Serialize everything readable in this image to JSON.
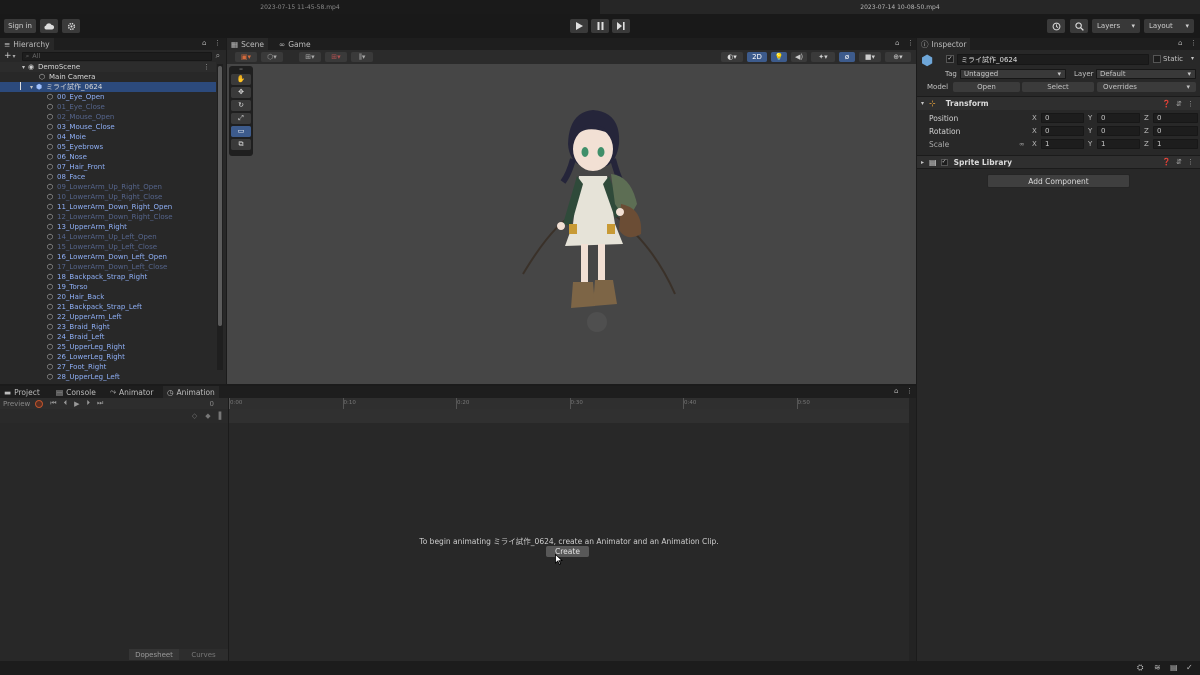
{
  "os_tabs": [
    "2023-07-15 11-45-58.mp4",
    "2023-07-14 10-08-50.mp4"
  ],
  "toolbar": {
    "sign_in": "Sign in",
    "layers": "Layers",
    "layout": "Layout"
  },
  "hierarchy": {
    "tab": "Hierarchy",
    "search_placeholder": "All",
    "scene": "DemoScene",
    "root_items": [
      {
        "label": "Main Camera",
        "state": "white"
      },
      {
        "label": "ミライ試作_0624",
        "state": "white"
      }
    ],
    "children": [
      {
        "label": "00_Eye_Open",
        "state": "blue"
      },
      {
        "label": "01_Eye_Close",
        "state": "dim"
      },
      {
        "label": "02_Mouse_Open",
        "state": "dim"
      },
      {
        "label": "03_Mouse_Close",
        "state": "blue"
      },
      {
        "label": "04_Moie",
        "state": "blue"
      },
      {
        "label": "05_Eyebrows",
        "state": "blue"
      },
      {
        "label": "06_Nose",
        "state": "blue"
      },
      {
        "label": "07_Hair_Front",
        "state": "blue"
      },
      {
        "label": "08_Face",
        "state": "blue"
      },
      {
        "label": "09_LowerArm_Up_Right_Open",
        "state": "dim"
      },
      {
        "label": "10_LowerArm_Up_Right_Close",
        "state": "dim"
      },
      {
        "label": "11_LowerArm_Down_Right_Open",
        "state": "blue"
      },
      {
        "label": "12_LowerArm_Down_Right_Close",
        "state": "dim"
      },
      {
        "label": "13_UpperArm_Right",
        "state": "blue"
      },
      {
        "label": "14_LowerArm_Up_Left_Open",
        "state": "dim"
      },
      {
        "label": "15_LowerArm_Up_Left_Close",
        "state": "dim"
      },
      {
        "label": "16_LowerArm_Down_Left_Open",
        "state": "blue"
      },
      {
        "label": "17_LowerArm_Down_Left_Close",
        "state": "dim"
      },
      {
        "label": "18_Backpack_Strap_Right",
        "state": "blue"
      },
      {
        "label": "19_Torso",
        "state": "blue"
      },
      {
        "label": "20_Hair_Back",
        "state": "blue"
      },
      {
        "label": "21_Backpack_Strap_Left",
        "state": "blue"
      },
      {
        "label": "22_UpperArm_Left",
        "state": "blue"
      },
      {
        "label": "23_Braid_Right",
        "state": "blue"
      },
      {
        "label": "24_Braid_Left",
        "state": "blue"
      },
      {
        "label": "25_UpperLeg_Right",
        "state": "blue"
      },
      {
        "label": "26_LowerLeg_Right",
        "state": "blue"
      },
      {
        "label": "27_Foot_Right",
        "state": "blue"
      },
      {
        "label": "28_UpperLeg_Left",
        "state": "blue"
      }
    ]
  },
  "scene": {
    "tabs": [
      "Scene",
      "Game"
    ],
    "mode_2d": "2D"
  },
  "inspector": {
    "tab": "Inspector",
    "object_name": "ミライ試作_0624",
    "static_label": "Static",
    "tag_label": "Tag",
    "tag_value": "Untagged",
    "layer_label": "Layer",
    "layer_value": "Default",
    "model_label": "Model",
    "open": "Open",
    "select": "Select",
    "overrides": "Overrides",
    "transform_title": "Transform",
    "position_label": "Position",
    "rotation_label": "Rotation",
    "scale_label": "Scale",
    "position": {
      "x": "0",
      "y": "0",
      "z": "0"
    },
    "rotation": {
      "x": "0",
      "y": "0",
      "z": "0"
    },
    "scale": {
      "x": "1",
      "y": "1",
      "z": "1"
    },
    "axis_x": "X",
    "axis_y": "Y",
    "axis_z": "Z",
    "sprite_library": "Sprite Library",
    "add_component": "Add Component"
  },
  "bottom": {
    "tabs": [
      "Project",
      "Console",
      "Animator",
      "Animation"
    ],
    "preview": "Preview",
    "frame": "0",
    "ruler": [
      "0:00",
      "0:10",
      "0:20",
      "0:30",
      "0:40",
      "0:50"
    ],
    "message": "To begin animating ミライ試作_0624, create an Animator and an Animation Clip.",
    "create": "Create",
    "dopesheet": "Dopesheet",
    "curves": "Curves"
  }
}
